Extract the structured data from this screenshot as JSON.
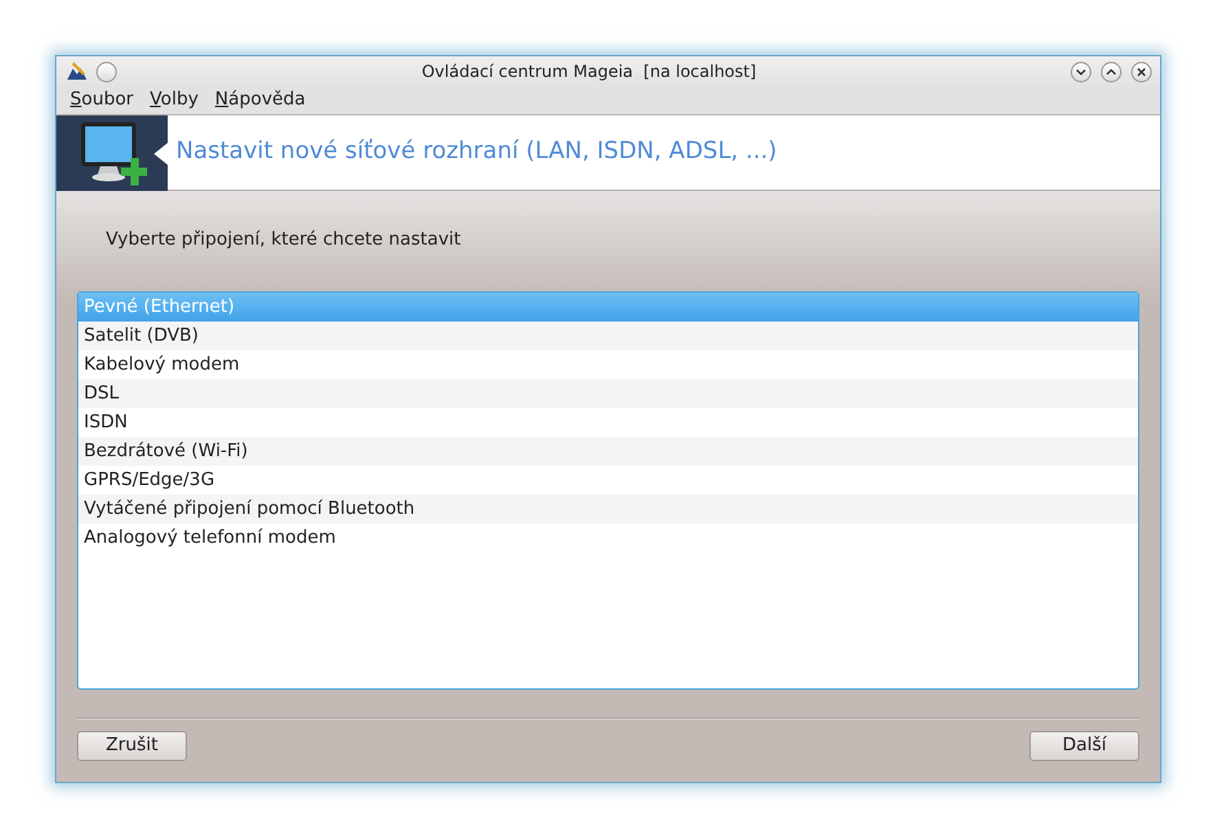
{
  "window": {
    "title": "Ovládací centrum Mageia  [na localhost]"
  },
  "menu": [
    {
      "mnemonic": "S",
      "rest": "oubor"
    },
    {
      "mnemonic": "V",
      "rest": "olby"
    },
    {
      "mnemonic": "N",
      "rest": "ápověda"
    }
  ],
  "banner": {
    "title": "Nastavit nové síťové rozhraní (LAN, ISDN, ADSL, ...)"
  },
  "prompt": "Vyberte připojení, které chcete nastavit",
  "connections": [
    {
      "label": "Pevné (Ethernet)",
      "selected": true
    },
    {
      "label": "Satelit (DVB)",
      "selected": false
    },
    {
      "label": "Kabelový modem",
      "selected": false
    },
    {
      "label": "DSL",
      "selected": false
    },
    {
      "label": "ISDN",
      "selected": false
    },
    {
      "label": "Bezdrátové (Wi-Fi)",
      "selected": false
    },
    {
      "label": "GPRS/Edge/3G",
      "selected": false
    },
    {
      "label": "Vytáčené připojení pomocí Bluetooth",
      "selected": false
    },
    {
      "label": "Analogový telefonní modem",
      "selected": false
    }
  ],
  "buttons": {
    "cancel": "Zrušit",
    "next": "Další"
  }
}
